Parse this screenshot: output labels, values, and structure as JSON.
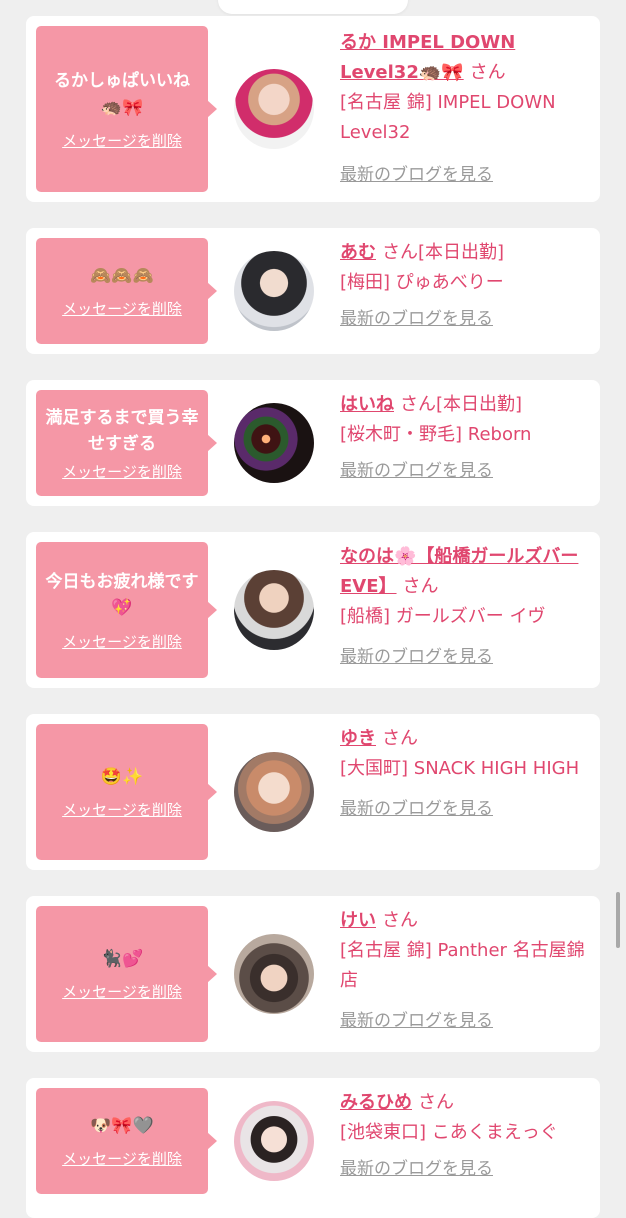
{
  "delete_label": "メッセージを削除",
  "blog_label": "最新のブログを見る",
  "san_label": "さん",
  "colors": {
    "accent": "#e0476f",
    "bubble": "#f597a6",
    "background": "#efefef"
  },
  "messages": [
    {
      "bubble_text": "るかしゅぱいいね",
      "bubble_emoji": "🦔🎀",
      "name": "るか IMPEL DOWN Level32🦔🎀",
      "status": "",
      "shop": "[名古屋 錦] IMPEL DOWN Level32",
      "avatar_icon": "avatar-photo"
    },
    {
      "bubble_text": "",
      "bubble_emoji": "🙈🙈🙈",
      "name": "あむ",
      "status": "[本日出勤]",
      "shop": "[梅田] ぴゅあべりー",
      "avatar_icon": "avatar-photo"
    },
    {
      "bubble_text": "満足するまで買う幸せすぎる",
      "bubble_emoji": "",
      "name": "はいね",
      "status": "[本日出勤]",
      "shop": "[桜木町・野毛] Reborn",
      "avatar_icon": "avatar-photo"
    },
    {
      "bubble_text": "今日もお疲れ様です💖",
      "bubble_emoji": "",
      "name": "なのは🌸【船橋ガールズバーEVE】",
      "status": "",
      "shop": "[船橋] ガールズバー イヴ",
      "avatar_icon": "avatar-photo"
    },
    {
      "bubble_text": "",
      "bubble_emoji": "🤩✨",
      "name": "ゆき",
      "status": "",
      "shop": "[大国町] SNACK HIGH HIGH",
      "avatar_icon": "avatar-photo"
    },
    {
      "bubble_text": "",
      "bubble_emoji": "🐈‍⬛💕",
      "name": "けい",
      "status": "",
      "shop": "[名古屋 錦] Panther 名古屋錦店",
      "avatar_icon": "avatar-photo"
    },
    {
      "bubble_text": "",
      "bubble_emoji": "🐶🎀🩶",
      "name": "みるひめ",
      "status": "",
      "shop": "[池袋東口] こあくまえっぐ",
      "avatar_icon": "avatar-photo"
    }
  ]
}
